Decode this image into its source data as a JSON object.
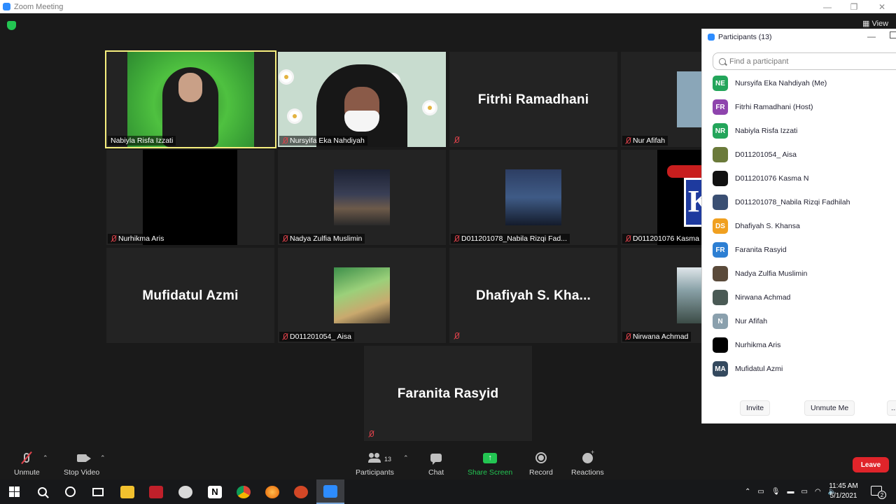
{
  "window": {
    "title": "Zoom Meeting"
  },
  "top": {
    "view_label": "View"
  },
  "tiles": {
    "t1": {
      "name": "Nabiyla Risfa Izzati"
    },
    "t2": {
      "name": "Nursyifa Eka Nahdiyah"
    },
    "t3": {
      "name": "Fitrhi Ramadhani"
    },
    "t4": {
      "name": "Nur Afifah"
    },
    "t5": {
      "name": "Nurhikma Aris"
    },
    "t6": {
      "name": "Nadya Zulfia Muslimin"
    },
    "t7": {
      "name": "D011201078_Nabila Rizqi Fad..."
    },
    "t8": {
      "name": "D011201076 Kasma"
    },
    "t9": {
      "name": "Mufidatul Azmi"
    },
    "t10": {
      "name": "D011201054_ Aisa"
    },
    "t11": {
      "name": "Dhafiyah S. Kha..."
    },
    "t12": {
      "name": "Nirwana Achmad"
    },
    "t13": {
      "name": "Faranita Rasyid"
    }
  },
  "participants_panel": {
    "title": "Participants (13)",
    "search_placeholder": "Find a participant",
    "items": [
      {
        "initials": "NE",
        "name": "Nursyifa Eka Nahdiyah (Me)",
        "color": "#23a55a"
      },
      {
        "initials": "FR",
        "name": "Fitrhi Ramadhani (Host)",
        "color": "#8e44ad"
      },
      {
        "initials": "NR",
        "name": "Nabiyla Risfa Izzati",
        "color": "#23a55a"
      },
      {
        "initials": "",
        "name": "D011201054_ Aisa",
        "color": "#6b7a3a"
      },
      {
        "initials": "",
        "name": "D011201076 Kasma N",
        "color": "#111111"
      },
      {
        "initials": "",
        "name": "D011201078_Nabila Rizqi Fadhilah",
        "color": "#3a4f73"
      },
      {
        "initials": "DS",
        "name": "Dhafiyah S. Khansa",
        "color": "#f0a020"
      },
      {
        "initials": "FR",
        "name": "Faranita Rasyid",
        "color": "#2d7fd3"
      },
      {
        "initials": "",
        "name": "Nadya Zulfia Muslimin",
        "color": "#5a4a3a"
      },
      {
        "initials": "",
        "name": "Nirwana Achmad",
        "color": "#4a5a55"
      },
      {
        "initials": "N",
        "name": "Nur Afifah",
        "color": "#8aa0ad"
      },
      {
        "initials": "",
        "name": "Nurhikma Aris",
        "color": "#000000"
      },
      {
        "initials": "MA",
        "name": "Mufidatul Azmi",
        "color": "#34495e"
      }
    ],
    "invite_label": "Invite",
    "unmute_me_label": "Unmute Me",
    "more_label": "..."
  },
  "toolbar": {
    "unmute": "Unmute",
    "stop_video": "Stop Video",
    "participants": "Participants",
    "participants_count": "13",
    "chat": "Chat",
    "share_screen": "Share Screen",
    "record": "Record",
    "reactions": "Reactions",
    "leave": "Leave"
  },
  "taskbar": {
    "time": "11:45 AM",
    "date": "5/1/2021",
    "notification_count": "2"
  },
  "colors": {
    "active_speaker_border": "#f7ef7e",
    "share_green": "#23c552",
    "leave_red": "#e0242a",
    "mute_red": "#e0424b"
  }
}
